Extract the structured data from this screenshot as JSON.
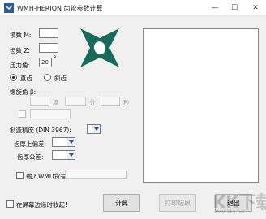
{
  "window": {
    "title": "WMH-HERION 齿轮参数计算",
    "minimize": "—",
    "maximize": "☐",
    "close": "✕"
  },
  "form": {
    "module_label": "模数 M:",
    "teeth_label": "齿数 Z:",
    "pressure_label": "压力角:",
    "pressure_value": "20",
    "degree_mark": "°",
    "spur_label": "直齿",
    "helical_label": "斜齿",
    "helix_label": "螺旋角 β:",
    "deg_unit": "度",
    "min_unit": "分",
    "sec_unit": "秒",
    "precision_label": "制造精度 (DIN 3967):",
    "upper_dev_label": "齿厚上偏差:",
    "tolerance_label": "齿厚公差:",
    "wmd_label": "输入WMD货号",
    "reset_label": "在屏幕边缘时收起!"
  },
  "buttons": {
    "calc": "计算",
    "print": "打印结果",
    "exit": "退出"
  },
  "watermark": {
    "text": "KK下载",
    "url": "www.kkx.net"
  },
  "colors": {
    "logo": "#1a6a5a"
  }
}
